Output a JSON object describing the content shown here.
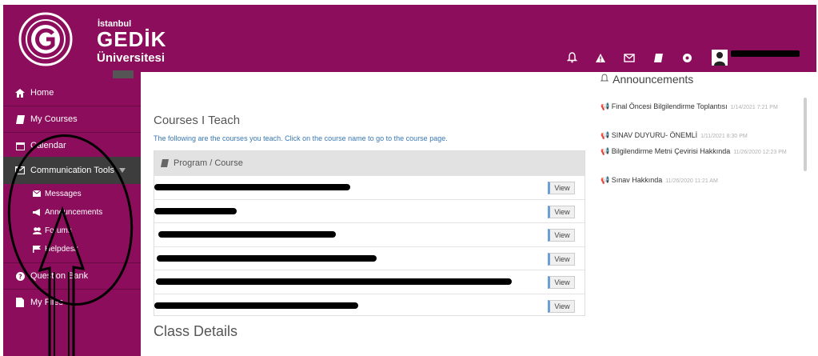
{
  "header": {
    "logo_line1": "İstanbul",
    "logo_line2": "GEDİK",
    "logo_line3": "Üniversitesi",
    "icons": [
      "bell-icon",
      "warning-icon",
      "envelope-icon",
      "book-icon",
      "help-icon",
      "user-icon"
    ]
  },
  "sidebar": {
    "items": [
      {
        "label": "Home",
        "icon": "home-icon"
      },
      {
        "label": "My Courses",
        "icon": "book-icon"
      },
      {
        "label": "Calendar",
        "icon": "calendar-icon"
      },
      {
        "label": "Communication Tools",
        "icon": "envelope-icon"
      },
      {
        "label": "Question Bank",
        "icon": "question-icon"
      },
      {
        "label": "My Files",
        "icon": "file-icon"
      }
    ],
    "subitems": [
      {
        "label": "Messages",
        "icon": "envelope-icon"
      },
      {
        "label": "Announcements",
        "icon": "megaphone-icon"
      },
      {
        "label": "Forums",
        "icon": "users-icon"
      },
      {
        "label": "Helpdesk",
        "icon": "flag-icon"
      }
    ]
  },
  "main": {
    "heading": "Courses I Teach",
    "description": "The following are the courses you teach. Click on the course name to go to the course page.",
    "panel_header": "Program / Course",
    "view_label": "View",
    "section_title": "Class Details",
    "course_count": 6
  },
  "announcements": {
    "title": "Announcements",
    "items": [
      {
        "title": "Final Öncesi Bilgilendirme Toplantısı",
        "date": "1/14/2021 7:21 PM"
      },
      {
        "title": "SINAV DUYURU- ÖNEMLİ",
        "date": "1/11/2021 8:30 PM"
      },
      {
        "title": "Bilgilendirme Metni Çevirisi Hakkında",
        "date": "11/26/2020 12:23 PM"
      },
      {
        "title": "Sınav Hakkında",
        "date": "11/26/2020 11:21 AM"
      }
    ]
  },
  "colors": {
    "brand": "#8c0d5c",
    "active_item": "#3d3d3d",
    "link": "#3a78b5"
  }
}
